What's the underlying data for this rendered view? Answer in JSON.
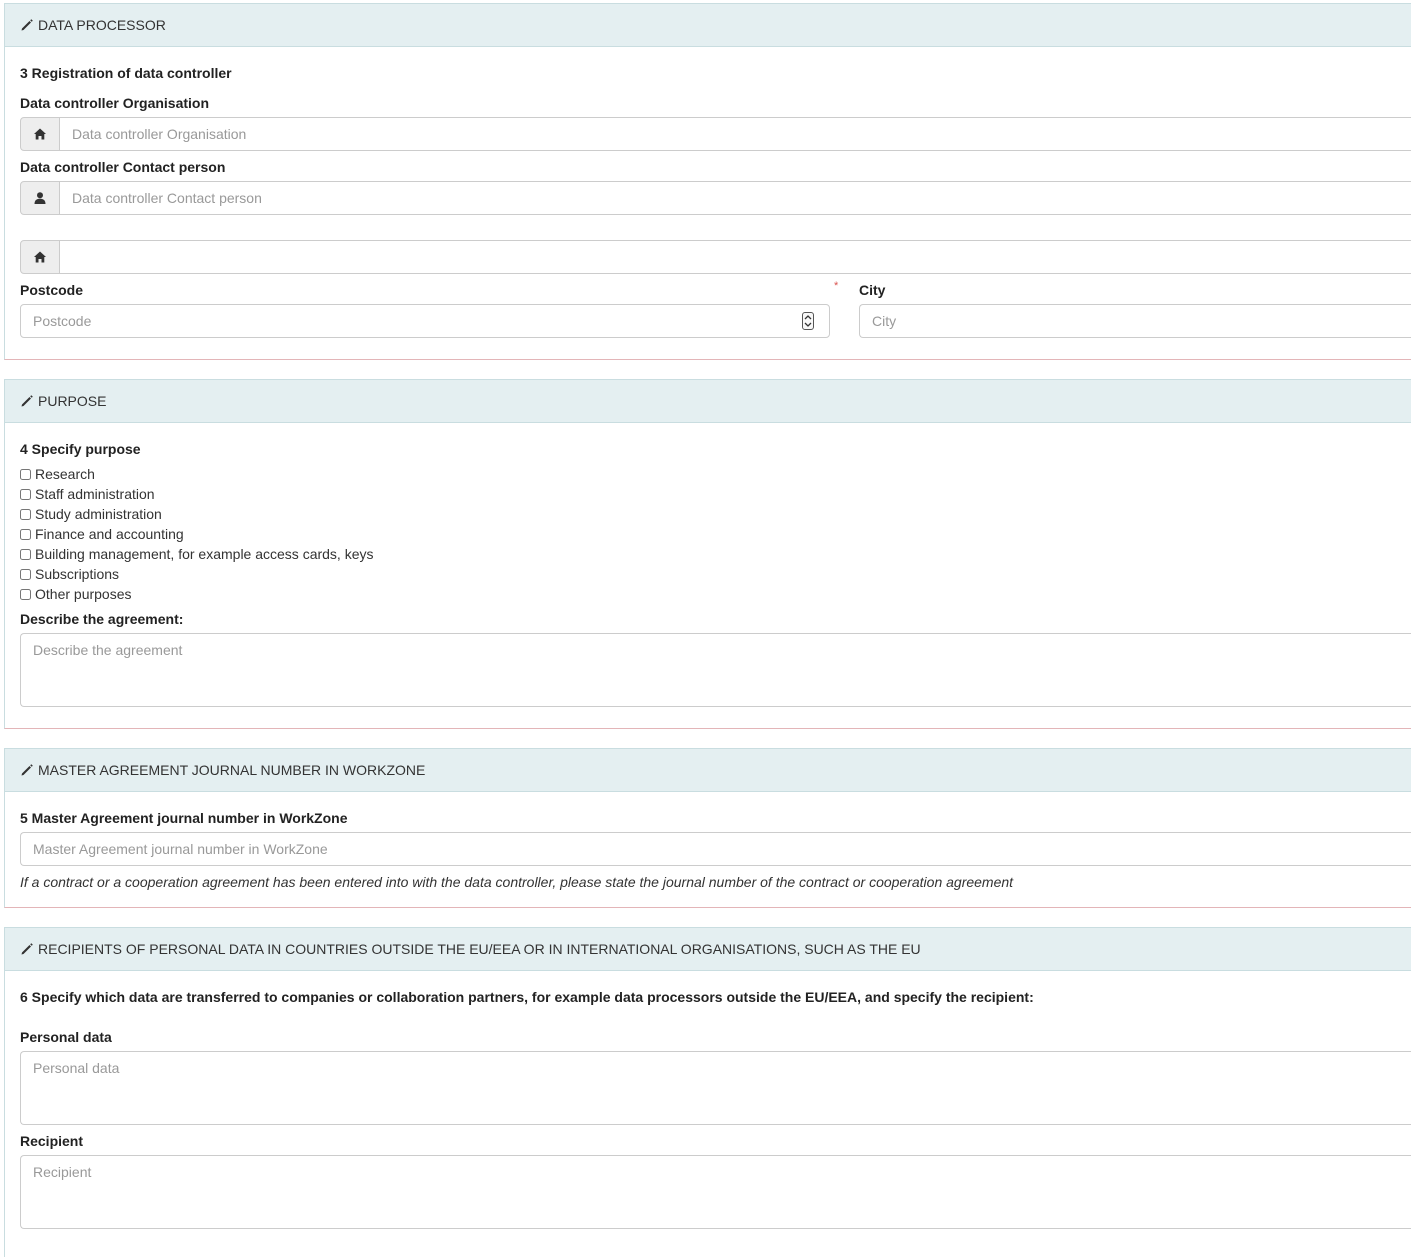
{
  "data_processor": {
    "heading": "DATA PROCESSOR",
    "section_title": "3 Registration of data controller",
    "org_label": "Data controller Organisation",
    "org_placeholder": "Data controller Organisation",
    "contact_label": "Data controller Contact person",
    "contact_placeholder": "Data controller Contact person",
    "address_value": "",
    "postcode_label": "Postcode",
    "postcode_placeholder": "Postcode",
    "required_mark": "*",
    "city_label": "City",
    "city_placeholder": "City"
  },
  "purpose": {
    "heading": "PURPOSE",
    "section_title": "4 Specify purpose",
    "options": [
      "Research",
      "Staff administration",
      "Study administration",
      "Finance and accounting",
      "Building management, for example access cards, keys",
      "Subscriptions",
      "Other purposes"
    ],
    "agreement_label": "Describe the agreement:",
    "agreement_placeholder": "Describe the agreement"
  },
  "master_agreement": {
    "heading": "MASTER AGREEMENT JOURNAL NUMBER IN WORKZONE",
    "section_title": "5 Master Agreement journal number in WorkZone",
    "placeholder": "Master Agreement journal number in WorkZone",
    "help": "If a contract or a cooperation agreement has been entered into with the data controller, please state the journal number of the contract or cooperation agreement"
  },
  "recipients": {
    "heading": "RECIPIENTS OF PERSONAL DATA IN COUNTRIES OUTSIDE THE EU/EEA OR IN INTERNATIONAL ORGANISATIONS, SUCH AS THE EU",
    "section_title": "6 Specify which data are transferred to companies or collaboration partners, for example data processors outside the EU/EEA, and specify the recipient:",
    "personal_label": "Personal data",
    "personal_placeholder": "Personal data",
    "recipient_label": "Recipient",
    "recipient_placeholder": "Recipient"
  },
  "icons": {
    "heading": "pencil-icon",
    "organisation": "home-icon",
    "contact": "user-icon",
    "address": "home-icon"
  }
}
